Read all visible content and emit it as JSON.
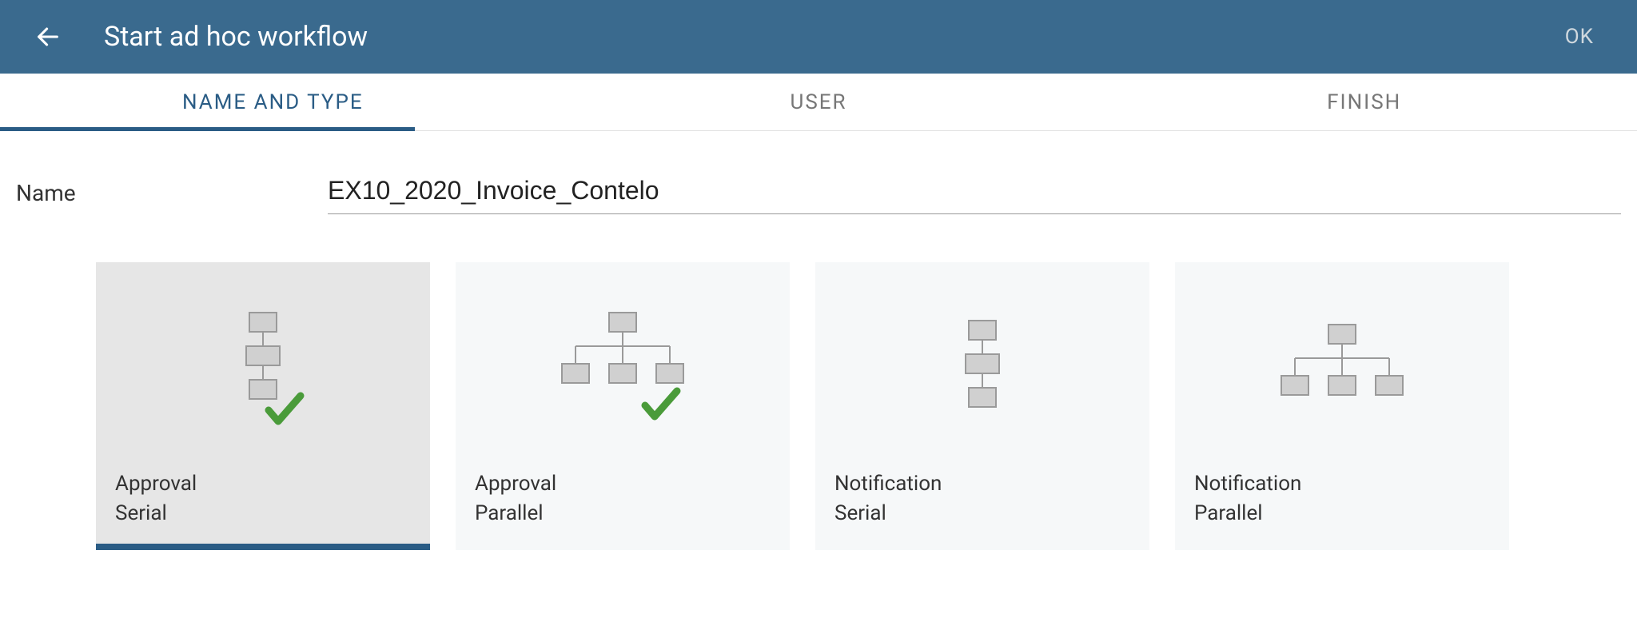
{
  "header": {
    "title": "Start ad hoc workflow",
    "ok_label": "OK"
  },
  "tabs": {
    "items": [
      {
        "label": "NAME AND TYPE",
        "active": true
      },
      {
        "label": "USER",
        "active": false
      },
      {
        "label": "FINISH",
        "active": false
      }
    ]
  },
  "form": {
    "name_label": "Name",
    "name_value": "EX10_2020_Invoice_Contelo"
  },
  "cards": [
    {
      "line1": "Approval",
      "line2": "Serial",
      "icon": "serial-check",
      "selected": true
    },
    {
      "line1": "Approval",
      "line2": "Parallel",
      "icon": "parallel-check",
      "selected": false
    },
    {
      "line1": "Notification",
      "line2": "Serial",
      "icon": "serial",
      "selected": false
    },
    {
      "line1": "Notification",
      "line2": "Parallel",
      "icon": "parallel",
      "selected": false
    }
  ]
}
